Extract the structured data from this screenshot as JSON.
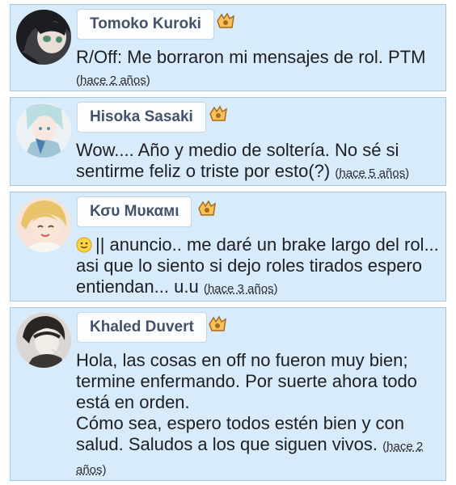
{
  "comments": [
    {
      "user": "Tomoko Kuroki",
      "text": "R/Off: Me borraron mi mensajes de rol. PTM",
      "time": "hace 2 años"
    },
    {
      "user": "Hisoka Sasaki",
      "text": "Wow.... Año y medio de soltería. No sé si sentirme feliz o triste por esto(?)",
      "time": "hace 5 años"
    },
    {
      "user": "Κσυ Μυκαмι",
      "emoji": "slightly-smiling-face",
      "text": "|| anuncio.. me daré un brake largo del rol... asi que lo siento si dejo roles tirados espero entiendan... u.u",
      "time": "hace 3 años"
    },
    {
      "user": "Khaled Duvert",
      "text_line1": "Hola, las cosas en off no fueron muy bien; termine enfermando. Por suerte ahora todo está en orden.",
      "text_line2": "Cómo sea, espero todos estén bien y con salud. Saludos a los que siguen vivos.",
      "time": "hace 2 años"
    }
  ],
  "colors": {
    "card_bg": "#d8ebfa",
    "card_border": "#a9c6de",
    "name": "#45526a",
    "badge": "#f0a43c"
  },
  "icons": [
    "level-badge-icon",
    "avatar"
  ]
}
